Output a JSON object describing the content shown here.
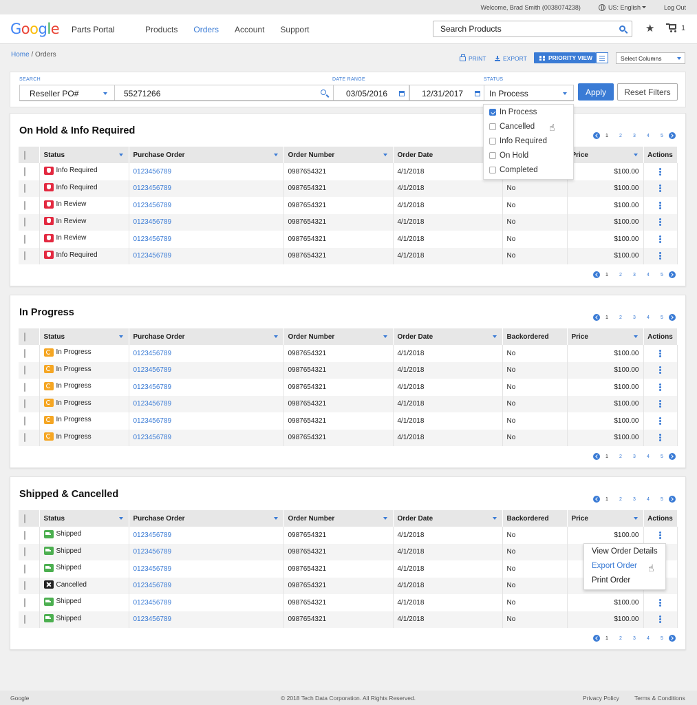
{
  "utility": {
    "welcome": "Welcome, Brad Smith (0038074238)",
    "language": "US: English",
    "logout": "Log Out"
  },
  "header": {
    "logo": [
      "G",
      "o",
      "o",
      "g",
      "l",
      "e"
    ],
    "portal": "Parts Portal",
    "nav": [
      "Products",
      "Orders",
      "Account",
      "Support"
    ],
    "search_placeholder": "Search Products",
    "cart_count": "1"
  },
  "breadcrumb": {
    "home": "Home",
    "sep": "/",
    "current": "Orders"
  },
  "toolbar": {
    "print": "PRINT",
    "export": "EXPORT",
    "priority_view": "PRIORITY VIEW",
    "select_columns": "Select Columns"
  },
  "filters": {
    "search_label": "SEARCH",
    "search_type": "Reseller PO#",
    "search_value": "55271266",
    "date_label": "DATE RANGE",
    "date_from": "03/05/2016",
    "date_to": "12/31/2017",
    "status_label": "STATUS",
    "status_value": "In Process",
    "apply": "Apply",
    "reset": "Reset Filters"
  },
  "status_options": [
    {
      "label": "In Process",
      "checked": true
    },
    {
      "label": "Cancelled",
      "checked": false
    },
    {
      "label": "Info Required",
      "checked": false
    },
    {
      "label": "On Hold",
      "checked": false
    },
    {
      "label": "Completed",
      "checked": false
    }
  ],
  "columns": [
    "Status",
    "Purchase Order",
    "Order Number",
    "Order Date",
    "Backordered",
    "Price",
    "Actions"
  ],
  "pager_pages": [
    "1",
    "2",
    "3",
    "4",
    "5"
  ],
  "sections": [
    {
      "title": "On Hold & Info Required",
      "rows": [
        {
          "status": "Info Required",
          "icon": "red",
          "po": "0123456789",
          "order": "0987654321",
          "date": "4/1/2018",
          "backordered": "No",
          "price": "$100.00"
        },
        {
          "status": "Info Required",
          "icon": "red",
          "po": "0123456789",
          "order": "0987654321",
          "date": "4/1/2018",
          "backordered": "No",
          "price": "$100.00"
        },
        {
          "status": "In Review",
          "icon": "red",
          "po": "0123456789",
          "order": "0987654321",
          "date": "4/1/2018",
          "backordered": "No",
          "price": "$100.00"
        },
        {
          "status": "In Review",
          "icon": "red",
          "po": "0123456789",
          "order": "0987654321",
          "date": "4/1/2018",
          "backordered": "No",
          "price": "$100.00"
        },
        {
          "status": "In Review",
          "icon": "red",
          "po": "0123456789",
          "order": "0987654321",
          "date": "4/1/2018",
          "backordered": "No",
          "price": "$100.00"
        },
        {
          "status": "Info Required",
          "icon": "red",
          "po": "0123456789",
          "order": "0987654321",
          "date": "4/1/2018",
          "backordered": "No",
          "price": "$100.00"
        }
      ]
    },
    {
      "title": "In Progress",
      "rows": [
        {
          "status": "In Progress",
          "icon": "orange",
          "po": "0123456789",
          "order": "0987654321",
          "date": "4/1/2018",
          "backordered": "No",
          "price": "$100.00"
        },
        {
          "status": "In Progress",
          "icon": "orange",
          "po": "0123456789",
          "order": "0987654321",
          "date": "4/1/2018",
          "backordered": "No",
          "price": "$100.00"
        },
        {
          "status": "In Progress",
          "icon": "orange",
          "po": "0123456789",
          "order": "0987654321",
          "date": "4/1/2018",
          "backordered": "No",
          "price": "$100.00"
        },
        {
          "status": "In Progress",
          "icon": "orange",
          "po": "0123456789",
          "order": "0987654321",
          "date": "4/1/2018",
          "backordered": "No",
          "price": "$100.00"
        },
        {
          "status": "In Progress",
          "icon": "orange",
          "po": "0123456789",
          "order": "0987654321",
          "date": "4/1/2018",
          "backordered": "No",
          "price": "$100.00"
        },
        {
          "status": "In Progress",
          "icon": "orange",
          "po": "0123456789",
          "order": "0987654321",
          "date": "4/1/2018",
          "backordered": "No",
          "price": "$100.00"
        }
      ]
    },
    {
      "title": "Shipped & Cancelled",
      "rows": [
        {
          "status": "Shipped",
          "icon": "green",
          "po": "0123456789",
          "order": "0987654321",
          "date": "4/1/2018",
          "backordered": "No",
          "price": "$100.00"
        },
        {
          "status": "Shipped",
          "icon": "green",
          "po": "0123456789",
          "order": "0987654321",
          "date": "4/1/2018",
          "backordered": "No",
          "price": ""
        },
        {
          "status": "Shipped",
          "icon": "green",
          "po": "0123456789",
          "order": "0987654321",
          "date": "4/1/2018",
          "backordered": "No",
          "price": ""
        },
        {
          "status": "Cancelled",
          "icon": "black",
          "po": "0123456789",
          "order": "0987654321",
          "date": "4/1/2018",
          "backordered": "No",
          "price": ""
        },
        {
          "status": "Shipped",
          "icon": "green",
          "po": "0123456789",
          "order": "0987654321",
          "date": "4/1/2018",
          "backordered": "No",
          "price": "$100.00"
        },
        {
          "status": "Shipped",
          "icon": "green",
          "po": "0123456789",
          "order": "0987654321",
          "date": "4/1/2018",
          "backordered": "No",
          "price": "$100.00"
        }
      ]
    }
  ],
  "action_menu": [
    "View Order Details",
    "Export Order",
    "Print Order"
  ],
  "footer": {
    "brand": "Google",
    "copyright": "© 2018 Tech Data Corporation. All Rights Reserved.",
    "privacy": "Privacy Policy",
    "terms": "Terms & Conditions"
  },
  "colors": {
    "accent": "#3a7bd5",
    "hold": "#e32940",
    "progress": "#f5a623",
    "shipped": "#4caf50",
    "cancelled": "#222222"
  }
}
